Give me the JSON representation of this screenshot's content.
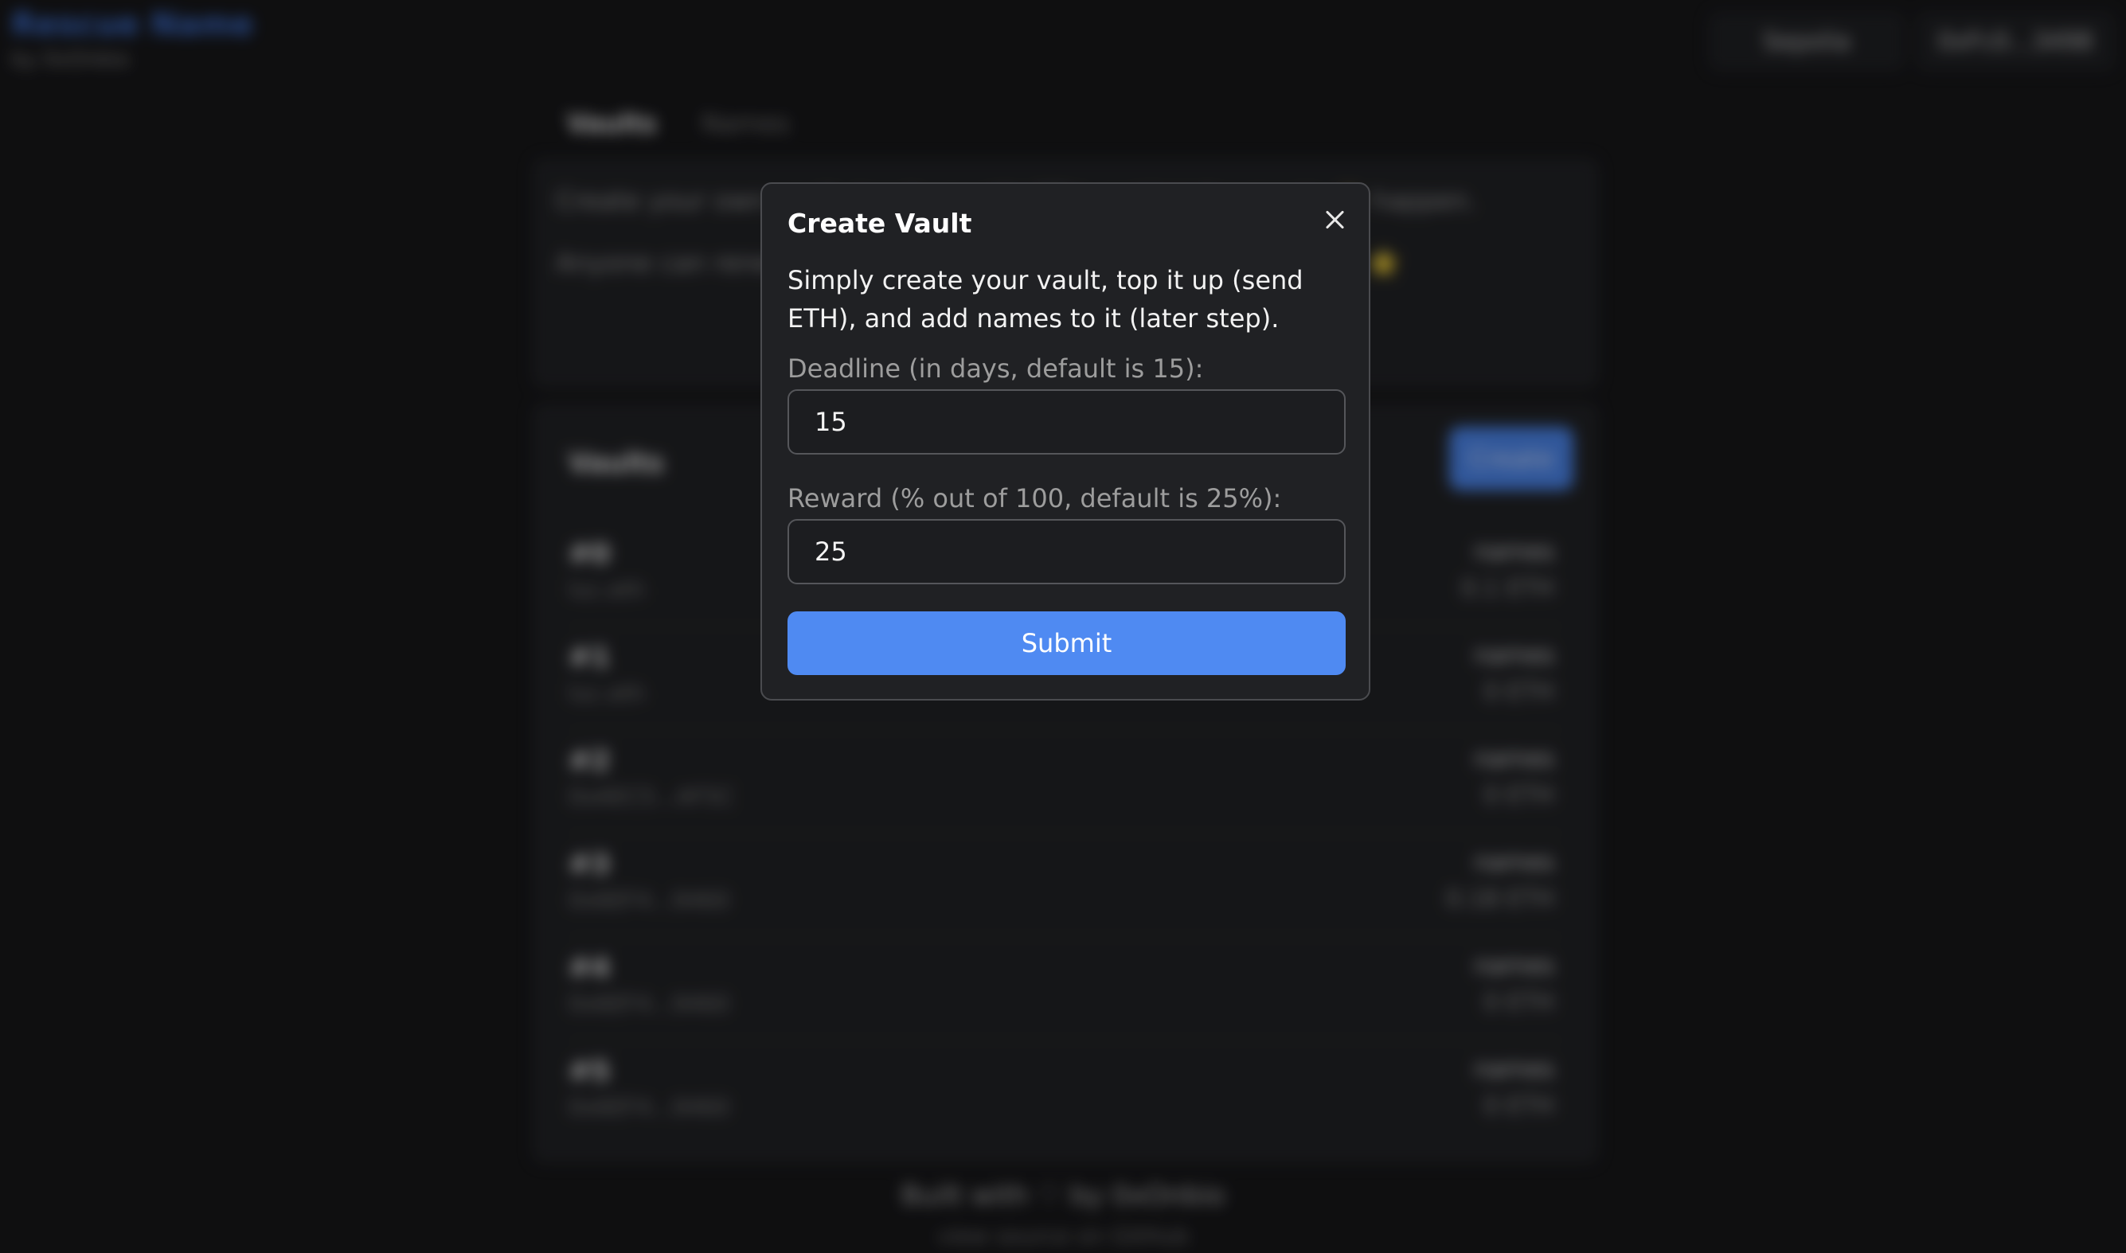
{
  "app": {
    "title": "Rescue Name",
    "subtitle": "by 0xOnbio",
    "network_button": "Sepolia",
    "account_button": "0xFc0...3498"
  },
  "tabs": [
    {
      "label": "Vaults",
      "active": true
    },
    {
      "label": "Names",
      "active": false
    }
  ],
  "intro": {
    "paragraph_1": "Create your own vault, top it up with ETH, and let the magic ✨ happen.",
    "paragraph_2": "Anyone can renew names in your vault and get a tiny kickback ⭐"
  },
  "vaults_section": {
    "title": "Vaults",
    "create_label": "Create",
    "rows": [
      {
        "id": "#0",
        "owner": "luc.eth",
        "names": "names",
        "eth": "0.1 ETH"
      },
      {
        "id": "#1",
        "owner": "luc.eth",
        "names": "names",
        "eth": "0 ETH"
      },
      {
        "id": "#2",
        "owner": "0xAEC5...AF5C",
        "names": "names",
        "eth": "0 ETH"
      },
      {
        "id": "#3",
        "owner": "0x6EF4...9460",
        "names": "names",
        "eth": "0.18 ETH"
      },
      {
        "id": "#4",
        "owner": "0x6EF4...9460",
        "names": "names",
        "eth": "0 ETH"
      },
      {
        "id": "#5",
        "owner": "0x6EF4...9460",
        "names": "names",
        "eth": "0 ETH"
      }
    ]
  },
  "footer": {
    "line_1": "Built with ♡ by 0xOnbio",
    "line_2": "view source on GitHub"
  },
  "modal": {
    "title": "Create Vault",
    "description": "Simply create your vault, top it up (send ETH), and add names to it (later step).",
    "deadline_label": "Deadline (in days, default is 15):",
    "deadline_value": "15",
    "reward_label": "Reward (% out of 100, default is 25%):",
    "reward_value": "25",
    "submit_label": "Submit"
  }
}
